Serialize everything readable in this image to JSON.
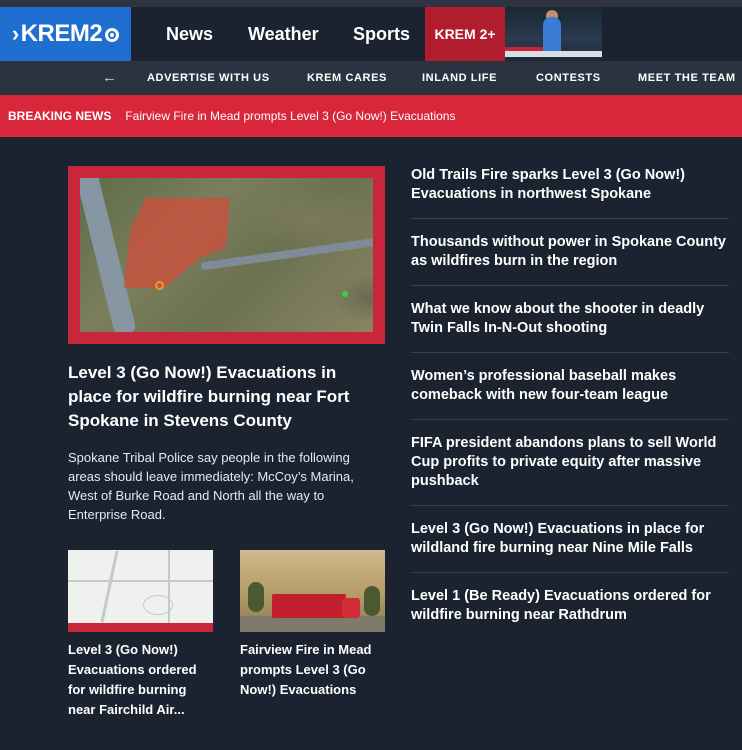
{
  "header": {
    "logo_text": "KREM2",
    "nav": [
      "News",
      "Weather",
      "Sports"
    ],
    "plus_label": "KREM 2+"
  },
  "subnav": {
    "items": [
      "ADVERTISE WITH US",
      "KREM CARES",
      "INLAND LIFE",
      "CONTESTS",
      "MEET THE TEAM"
    ]
  },
  "breaking": {
    "label": "BREAKING NEWS",
    "text": "Fairview Fire in Mead prompts Level 3 (Go Now!) Evacuations"
  },
  "hero": {
    "title": "Level 3 (Go Now!) Evacuations in place for wildfire burning near Fort Spokane in Stevens County",
    "description": "Spokane Tribal Police say people in the following areas should leave immediately: McCoy’s Marina, West of Burke Road and North all the way to Enterprise Road."
  },
  "cards": [
    {
      "title": "Level 3 (Go Now!) Evacuations ordered for wildfire burning near Fairchild Air..."
    },
    {
      "title": "Fairview Fire in Mead prompts Level 3 (Go Now!) Evacuations"
    }
  ],
  "headlines": [
    "Old Trails Fire sparks Level 3 (Go Now!) Evacuations in northwest Spokane",
    "Thousands without power in Spokane County as wildfires burn in the region",
    "What we know about the shooter in deadly Twin Falls In-N-Out shooting",
    "Women’s professional baseball makes comeback with new four-team league",
    "FIFA president abandons plans to sell World Cup profits to private equity after massive pushback",
    "Level 3 (Go Now!) Evacuations in place for wildland fire burning near Nine Mile Falls",
    "Level 1 (Be Ready) Evacuations ordered for wildfire burning near Rathdrum"
  ],
  "colors": {
    "brand_blue": "#1f6fd1",
    "breaking_red": "#d8263a",
    "plus_red": "#b21d2e",
    "background": "#1b2230"
  }
}
